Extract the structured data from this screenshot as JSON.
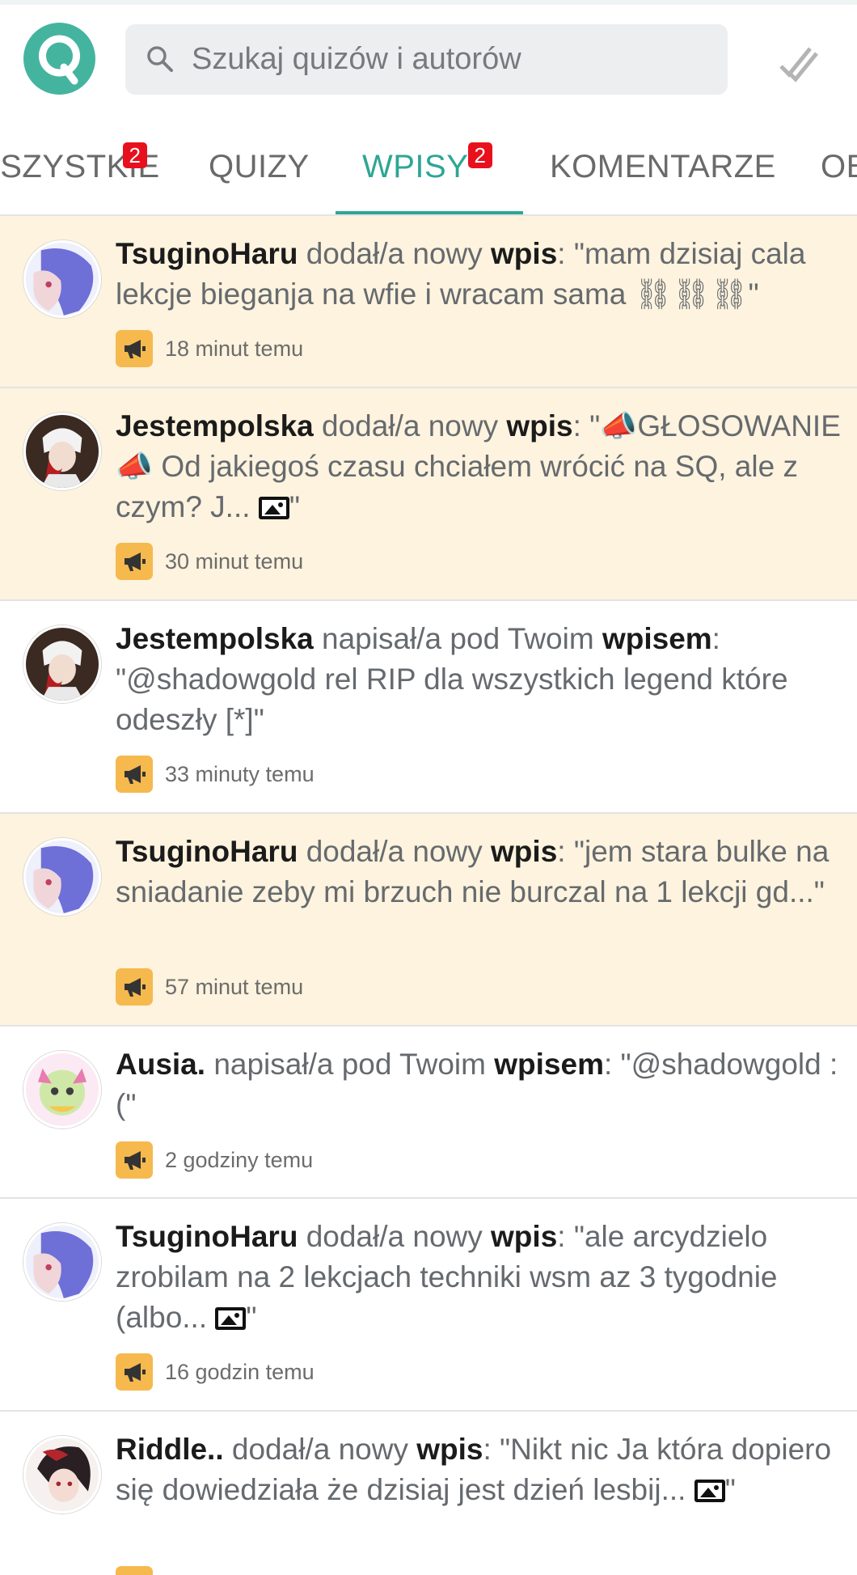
{
  "search": {
    "placeholder": "Szukaj quizów i autorów"
  },
  "tabs": [
    {
      "label": "WSZYSTKIE",
      "badge": "2"
    },
    {
      "label": "QUIZY",
      "badge": ""
    },
    {
      "label": "WPISY",
      "badge": "2",
      "active": true
    },
    {
      "label": "KOMENTARZE",
      "badge": ""
    },
    {
      "label": "OBSERWUJĄCY",
      "badge": ""
    }
  ],
  "feed": [
    {
      "user": "TsuginoHaru",
      "action": " dodał/a nowy ",
      "object": "wpis",
      "content": ": \"mam dzisiaj cala lekcje bieganja na wfie i wracam sama ⛓⛓⛓\"",
      "time": "18 minut temu",
      "unread": true
    },
    {
      "user": "Jestempolska",
      "action": " dodał/a nowy ",
      "object": "wpis",
      "content_pre": ": \"📣GŁOSOWANIE 📣 Od jakiegoś czasu chciałem wrócić na SQ, ale z czym? J... ",
      "content_post": "\"",
      "time": "30 minut temu",
      "unread": true
    },
    {
      "user": "Jestempolska",
      "action": " napisał/a pod Twoim ",
      "object": "wpisem",
      "content": ": \"@shadowgold rel RIP dla wszystkich legend które odeszły [*]\"",
      "time": "33 minuty temu",
      "unread": false
    },
    {
      "user": "TsuginoHaru",
      "action": " dodał/a nowy ",
      "object": "wpis",
      "content": ": \"jem stara bulke na sniadanie zeby mi brzuch nie burczal na 1 lekcji gd...\"",
      "time": "57 minut temu",
      "unread": true
    },
    {
      "user": "Ausia.",
      "action": " napisał/a pod Twoim ",
      "object": "wpisem",
      "content": ": \"@shadowgold :(\"",
      "time": "2 godziny temu",
      "unread": false
    },
    {
      "user": "TsuginoHaru",
      "action": " dodał/a nowy ",
      "object": "wpis",
      "content_pre": ": \"ale arcydzielo zrobilam na 2 lekcjach techniki wsm az 3 tygodnie (albo... ",
      "content_post": "\"",
      "time": "16 godzin temu",
      "unread": false
    },
    {
      "user": "Riddle..",
      "action": " dodał/a nowy ",
      "object": "wpis",
      "content_pre": ": \"Nikt nic Ja która dopiero się dowiedziała że dzisiaj jest dzień lesbij... ",
      "content_post": "\"",
      "time": "",
      "unread": false
    }
  ]
}
